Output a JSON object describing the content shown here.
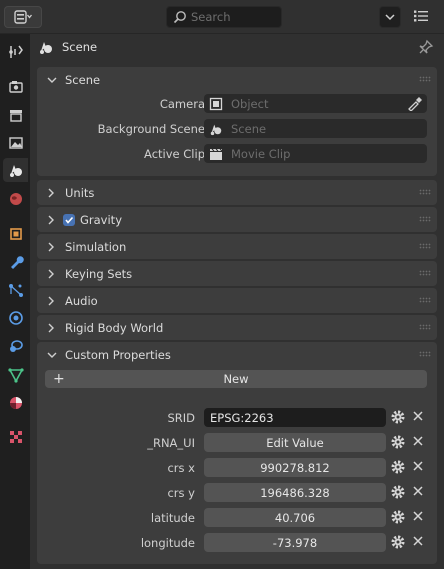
{
  "header": {
    "search_placeholder": "Search"
  },
  "tabs": [
    {
      "name": "tool-tab",
      "icon": "tool-icon"
    },
    {
      "name": "render-tab",
      "icon": "render-icon"
    },
    {
      "name": "output-tab",
      "icon": "output-icon"
    },
    {
      "name": "view-layer-tab",
      "icon": "view-layer-icon"
    },
    {
      "name": "scene-tab",
      "icon": "scene-icon",
      "active": true
    },
    {
      "name": "world-tab",
      "icon": "world-icon"
    },
    {
      "name": "object-tab",
      "icon": "object-icon"
    },
    {
      "name": "modifier-tab",
      "icon": "wrench-icon"
    },
    {
      "name": "particles-tab",
      "icon": "particles-icon"
    },
    {
      "name": "physics-tab",
      "icon": "physics-icon"
    },
    {
      "name": "constraints-tab",
      "icon": "constraint-icon"
    },
    {
      "name": "data-tab",
      "icon": "mesh-data-icon"
    },
    {
      "name": "material-tab",
      "icon": "material-icon"
    },
    {
      "name": "texture-tab",
      "icon": "texture-icon"
    }
  ],
  "context": {
    "label": "Scene"
  },
  "scene_panel": {
    "title": "Scene",
    "rows": [
      {
        "label": "Camera",
        "placeholder": "Object",
        "icon": "camera-object-icon"
      },
      {
        "label": "Background Scene",
        "placeholder": "Scene",
        "icon": "scene-icon"
      },
      {
        "label": "Active Clip",
        "placeholder": "Movie Clip",
        "icon": "clapper-icon"
      }
    ]
  },
  "collapsed_panels": [
    {
      "title": "Units"
    },
    {
      "title": "Gravity",
      "checkbox": true
    },
    {
      "title": "Simulation"
    },
    {
      "title": "Keying Sets"
    },
    {
      "title": "Audio"
    },
    {
      "title": "Rigid Body World"
    }
  ],
  "custom_properties": {
    "title": "Custom Properties",
    "new_label": "New",
    "props": [
      {
        "name": "SRID",
        "value": "EPSG:2263",
        "kind": "text"
      },
      {
        "name": "_RNA_UI",
        "value": "Edit Value",
        "kind": "button"
      },
      {
        "name": "crs x",
        "value": "990278.812",
        "kind": "number"
      },
      {
        "name": "crs y",
        "value": "196486.328",
        "kind": "number"
      },
      {
        "name": "latitude",
        "value": "40.706",
        "kind": "number"
      },
      {
        "name": "longitude",
        "value": "-73.978",
        "kind": "number"
      }
    ]
  },
  "colors": {
    "background": "#303030",
    "panel": "#3d3d3d",
    "field": "#2a2a2a",
    "button": "#545454",
    "accent": "#4772b3"
  }
}
